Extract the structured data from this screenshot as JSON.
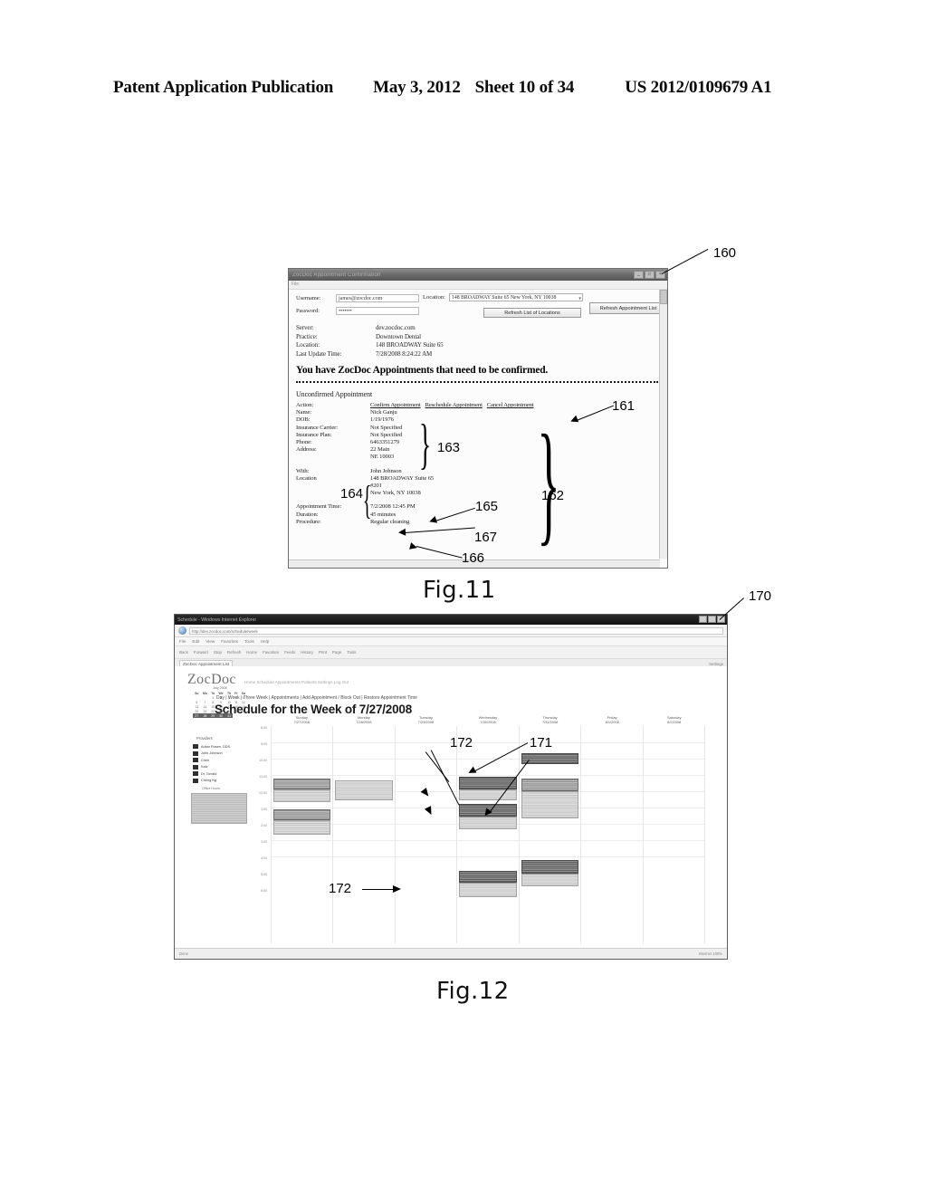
{
  "header": {
    "publication": "Patent Application Publication",
    "date": "May 3, 2012",
    "sheet": "Sheet 10 of 34",
    "patent_number": "US 2012/0109679 A1"
  },
  "fig11": {
    "label": "Fig.11",
    "callout": "160",
    "window": {
      "title": "ZocDoc Appointment Confirmation",
      "menu": "File",
      "buttons": {
        "minimize": "_",
        "maximize": "□",
        "close": "×"
      }
    },
    "credentials": {
      "username_label": "Username:",
      "username_value": "james@zocdoc.com",
      "password_label": "Password:",
      "password_value": "•••••••",
      "location_label": "Location:",
      "location_value": "148 BROADWAY Suite 65 New York, NY 10038",
      "refresh_locations_button": "Refresh List of Locations",
      "refresh_appointments_button": "Refresh Appointment List"
    },
    "info": [
      {
        "key": "Server:",
        "value": "dev.zocdoc.com"
      },
      {
        "key": "Practice:",
        "value": "Downtown Dental"
      },
      {
        "key": "Location:",
        "value": "148 BROADWAY Suite 65"
      },
      {
        "key": "Last Update Time:",
        "value": "7/28/2008 8:24:22 AM"
      }
    ],
    "headline": "You have ZocDoc Appointments that need to be confirmed.",
    "subhead": "Unconfirmed Appointment",
    "action": {
      "key": "Action:",
      "links": [
        "Confirm Appointment",
        "Reschedule Appointment",
        "Cancel Appointment"
      ]
    },
    "patient": [
      {
        "key": "Name:",
        "value": "Nick Ganju"
      },
      {
        "key": "DOB:",
        "value": "1/19/1976"
      },
      {
        "key": "Insurance Carrier:",
        "value": "Not Specified"
      },
      {
        "key": "Insurance Plan:",
        "value": "Not Specified"
      },
      {
        "key": "Phone:",
        "value": "6463351279"
      },
      {
        "key": "Address:",
        "value": "22 Main"
      }
    ],
    "address_line2": "NE 10003",
    "provider": [
      {
        "key": "With:",
        "value": "John Johnson"
      },
      {
        "key": "Location",
        "value": "148 BROADWAY Suite 65"
      }
    ],
    "provider_extra": [
      "#201",
      "New York, NY 10038"
    ],
    "appointment": [
      {
        "key": "Appointment Time:",
        "value": "7/2/2008 12:45 PM"
      },
      {
        "key": "Duration:",
        "value": "45 minutes"
      },
      {
        "key": "Procedure:",
        "value": "Regular cleaning"
      }
    ],
    "callouts": {
      "c161": "161",
      "c162": "162",
      "c163": "163",
      "c164": "164",
      "c165": "165",
      "c166": "166",
      "c167": "167"
    }
  },
  "fig12": {
    "label": "Fig.12",
    "callout": "170",
    "browser": {
      "title": "Schedule - Windows Internet Explorer",
      "address": "http://dev.zocdoc.com/schedule/week",
      "menu_items": [
        "File",
        "Edit",
        "View",
        "Favorites",
        "Tools",
        "Help"
      ],
      "toolbar_items": [
        "Back",
        "Forward",
        "Stop",
        "Refresh",
        "Home",
        "Favorites",
        "Feeds",
        "History",
        "Print",
        "Page",
        "Tools"
      ],
      "tab_label": "ZocDoc Appointment List",
      "tools_right": "Settings",
      "status_left": "Done",
      "status_right": "Internet  100%"
    },
    "app": {
      "logo": "ZocDoc",
      "nav": "Home   Schedule   Appointments   Patients   Settings   Log Out",
      "tabs": "Day | Week | Three Week | Appointments | Add Appointment / Block Out | Restore Appointment Time",
      "heading": "Schedule for the Week of 7/27/2008",
      "minical": {
        "title": "July 2008",
        "weekdays": [
          "Su",
          "Mo",
          "Tu",
          "We",
          "Th",
          "Fr",
          "Sa"
        ],
        "weeks": [
          [
            "",
            "",
            "1",
            "2",
            "3",
            "4",
            "5"
          ],
          [
            "6",
            "7",
            "8",
            "9",
            "10",
            "11",
            "12"
          ],
          [
            "13",
            "14",
            "15",
            "16",
            "17",
            "18",
            "19"
          ],
          [
            "20",
            "21",
            "22",
            "23",
            "24",
            "25",
            "26"
          ],
          [
            "27",
            "28",
            "29",
            "30",
            "31",
            "",
            ""
          ]
        ],
        "selected_week_index": 4
      },
      "providers_heading": "Providers",
      "providers": [
        "Adam Rosen, DDS",
        "John Johnson",
        "Chen",
        "Katz",
        "Dr. Gerald",
        "Cheng Ng"
      ],
      "sidebar_label": "Office Hours",
      "day_columns": [
        {
          "day": "Sunday",
          "date": "7/27/2008"
        },
        {
          "day": "Monday",
          "date": "7/28/2008"
        },
        {
          "day": "Tuesday",
          "date": "7/29/2008"
        },
        {
          "day": "Wednesday",
          "date": "7/30/2008"
        },
        {
          "day": "Thursday",
          "date": "7/31/2008"
        },
        {
          "day": "Friday",
          "date": "8/1/2008"
        },
        {
          "day": "Saturday",
          "date": "8/2/2008"
        }
      ],
      "time_slots": [
        "8:00",
        "9:00",
        "10:00",
        "11:00",
        "12:00",
        "1:00",
        "2:00",
        "3:00",
        "4:00",
        "5:00",
        "6:00"
      ]
    },
    "callouts": {
      "c171": "171",
      "c172a": "172",
      "c172b": "172"
    }
  }
}
